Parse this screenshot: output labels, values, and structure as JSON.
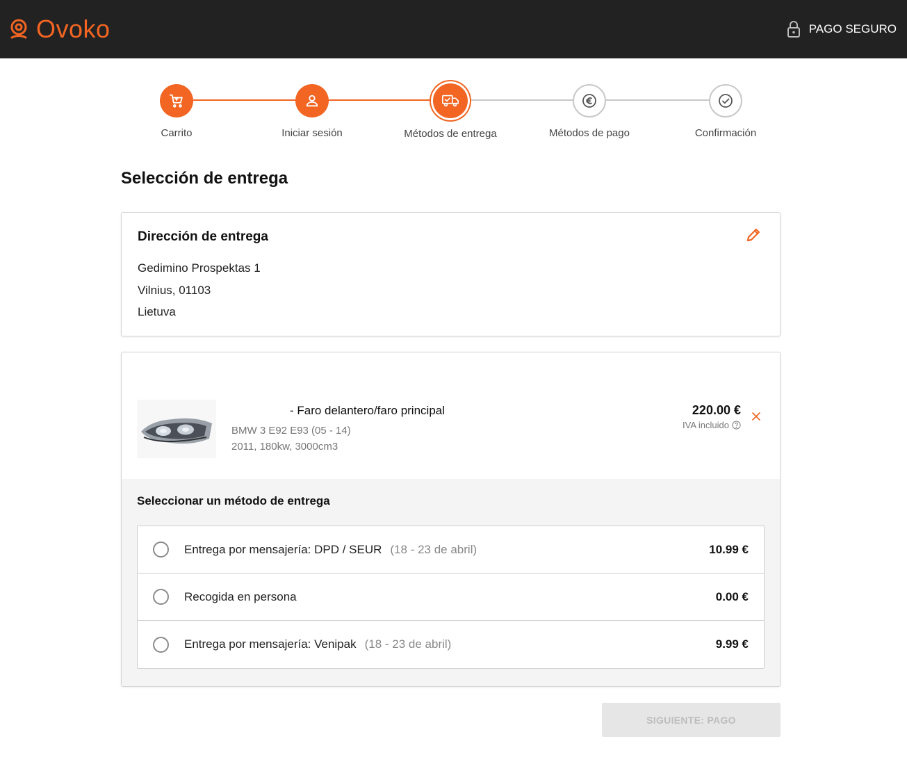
{
  "header": {
    "brand": "Ovoko",
    "brand_color": "#f26522",
    "secure_label": "PAGO SEGURO",
    "secure_icon": "lock-icon"
  },
  "steps": [
    {
      "label": "Carrito",
      "state": "done",
      "icon": "cart-icon"
    },
    {
      "label": "Iniciar sesión",
      "state": "done",
      "icon": "user-icon"
    },
    {
      "label": "Métodos de entrega",
      "state": "active",
      "icon": "delivery-truck-icon"
    },
    {
      "label": "Métodos de pago",
      "state": "todo",
      "icon": "euro-icon"
    },
    {
      "label": "Confirmación",
      "state": "todo",
      "icon": "check-circle-icon"
    }
  ],
  "page_title": "Selección de entrega",
  "address": {
    "title": "Dirección de entrega",
    "line1": "Gedimino Prospektas 1",
    "line2": "Vilnius, 01103",
    "line3": "Lietuva"
  },
  "product": {
    "name": "- Faro delantero/faro principal",
    "vehicle": "BMW 3 E92 E93 (05 - 14)",
    "specs": "2011, 180kw, 3000cm3",
    "price": "220.00 €",
    "vat": "IVA incluido"
  },
  "delivery": {
    "title": "Seleccionar un método de entrega",
    "options": [
      {
        "label": "Entrega por mensajería: DPD / SEUR",
        "date": "(18 - 23 de abril)",
        "price": "10.99 €"
      },
      {
        "label": "Recogida en persona",
        "date": "",
        "price": "0.00 €"
      },
      {
        "label": "Entrega por mensajería: Venipak",
        "date": "(18 - 23 de abril)",
        "price": "9.99 €"
      }
    ]
  },
  "next_button": "SIGUIENTE: PAGO"
}
